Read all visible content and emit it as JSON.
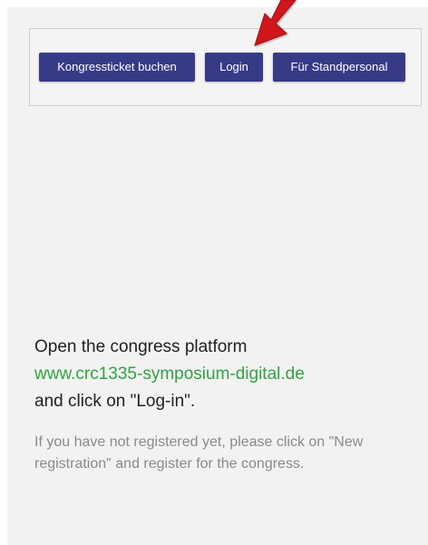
{
  "buttons": {
    "ticket": "Kongressticket buchen",
    "login": "Login",
    "staff": "Für Standpersonal"
  },
  "instructions": {
    "line1": "Open the congress platform",
    "link": "www.crc1335-symposium-digital.de",
    "line3": "and click on \"Log-in\".",
    "note": "If you have not registered yet, please click on \"New registration\" and register for the congress."
  },
  "colors": {
    "button_bg": "#373a87",
    "link": "#31a342",
    "arrow": "#d0141b"
  },
  "icons": {
    "pointer": "red-arrow-icon"
  }
}
